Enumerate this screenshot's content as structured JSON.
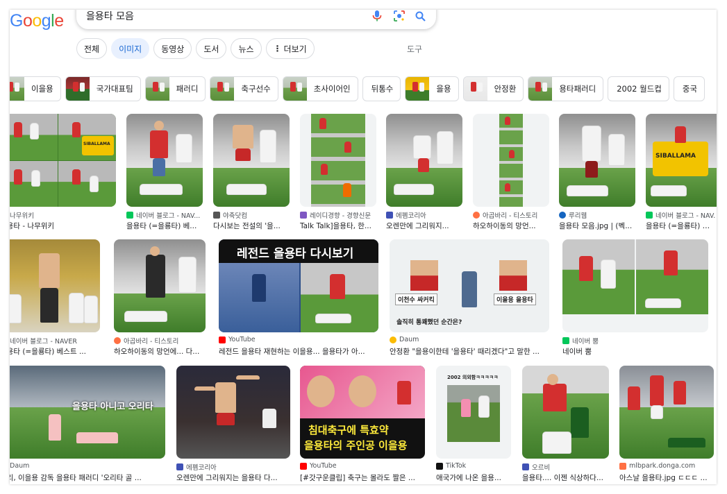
{
  "search": {
    "query": "을용타 모음"
  },
  "nav": {
    "tabs": [
      "전체",
      "이미지",
      "동영상",
      "도서",
      "뉴스"
    ],
    "more": "더보기",
    "tools": "도구"
  },
  "refine": [
    "이을용",
    "국가대표팀",
    "패러디",
    "축구선수",
    "초사이어인",
    "뒤통수",
    "을용",
    "안정환",
    "용타패러디",
    "2002 월드컵",
    "중국"
  ],
  "results": [
    {
      "source": "나무위키",
      "title": "을용타 - 나무위키"
    },
    {
      "source": "네이버 블로그 - NAV...",
      "title": "을용타 (=을룡타) 베..."
    },
    {
      "source": "야축닷컴",
      "title": "다시보는 전설의 '을..."
    },
    {
      "source": "레이디경향 - 경향신문",
      "title": "Talk Talk]을용타, 한..."
    },
    {
      "source": "에펨코리아",
      "title": "오렌만에 그리워지..."
    },
    {
      "source": "아곱바리 - 티스토리",
      "title": "하오하이동의 망언..."
    },
    {
      "source": "루리웹",
      "title": "을용타 모음.jpg | (벡..."
    },
    {
      "source": "네이버 블로그 - NAV...",
      "title": "을용타 (=을룡타) 베..."
    },
    {
      "source": "네이버 블로그 - NAVER",
      "title": "을용타 (=을룡타) 베스트 ..."
    },
    {
      "source": "아곱바리 - 티스토리",
      "title": "하오하이동의 망언에... 다..."
    },
    {
      "source": "YouTube",
      "title": "레전드 을용타 재현하는 이을용... 을용타가 아..."
    },
    {
      "source": "Daum",
      "title": "안정환 \"을용이한테 '을용타' 때리겠다\"고 말한 ..."
    },
    {
      "source": "네이버 뿜",
      "title": "네이버 뿜"
    },
    {
      "source": "Daum",
      "title": "오리, 이을용 감독 을용타 패러디 '오리타 골 ..."
    },
    {
      "source": "에펨코리아",
      "title": "오렌만에 그리워지는 을용타 다..."
    },
    {
      "source": "YouTube",
      "title": "[#갓구운클립] 축구는 몰라도 짤은 ..."
    },
    {
      "source": "TikTok",
      "title": "애국가에 나온 을용..."
    },
    {
      "source": "오르비",
      "title": "을용타.... 이젠 식상하다..."
    },
    {
      "source": "mlbpark.donga.com",
      "title": "아스날 을용타.jpg ㄷㄷㄷ ..."
    }
  ],
  "overlays": {
    "sibalama": "SIBALLAMA",
    "legend": "레전드 을용타 다시보기",
    "face_left": "이천수 싸커킥",
    "face_right": "이을용 을용타",
    "question": "솔직히 통쾌했던 순간은?",
    "parody": "을용타 아니고 오리타",
    "bed_line1": "침대축구에 특효약",
    "bed_line2": "을용타의 주인공 이을용",
    "tiktok_cap": "2002 의외함ㅋㅋㅋㅋㅋ"
  },
  "colors": {
    "accent": "#1a73e8",
    "active_chip_bg": "#e8f0fe"
  }
}
